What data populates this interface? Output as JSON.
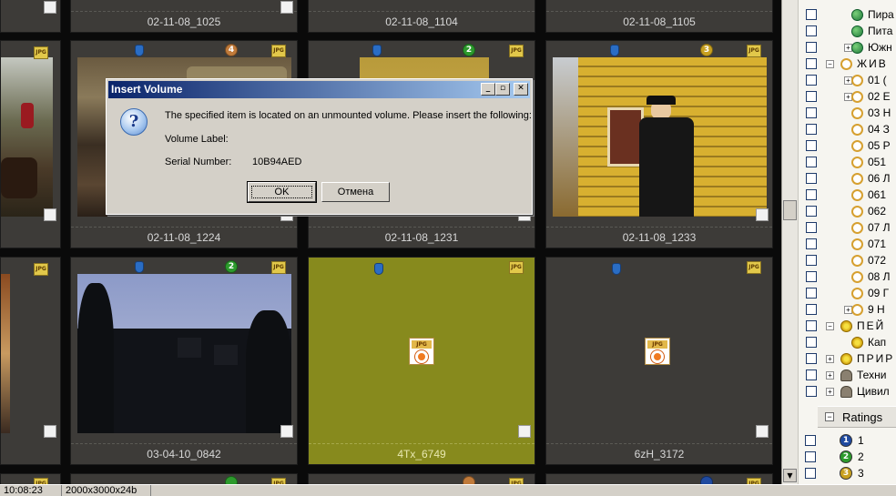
{
  "grid": {
    "thumbnails": [
      {
        "name": "02-11-08_1025"
      },
      {
        "name": "02-11-08_1104"
      },
      {
        "name": "02-11-08_1105"
      },
      {
        "name": "02-11-08_1224",
        "badge": "4"
      },
      {
        "name": "02-11-08_1231",
        "badge": "2"
      },
      {
        "name": "02-11-08_1233",
        "badge": "3"
      },
      {
        "name": "03-04-10_0842",
        "badge": "2"
      },
      {
        "name": "4Tx_6749"
      },
      {
        "name": "6zH_3172"
      }
    ],
    "file_type_label": "JPG",
    "selected_color": "#878a1d"
  },
  "tree": {
    "items": [
      {
        "label": "Пира",
        "icon": "globe-icon"
      },
      {
        "label": "Пита",
        "icon": "globe-icon"
      },
      {
        "label": "Южн",
        "icon": "globe-icon"
      },
      {
        "label": "ЖИВ",
        "icon": "tag-icon"
      },
      {
        "label": "01 (",
        "icon": "tag-icon"
      },
      {
        "label": "02 Е",
        "icon": "tag-icon"
      },
      {
        "label": "03 Н",
        "icon": "tag-icon"
      },
      {
        "label": "04 З",
        "icon": "tag-icon"
      },
      {
        "label": "05 Р",
        "icon": "tag-icon"
      },
      {
        "label": "051",
        "icon": "tag-icon"
      },
      {
        "label": "06 Л",
        "icon": "tag-icon"
      },
      {
        "label": "061",
        "icon": "tag-icon"
      },
      {
        "label": "062",
        "icon": "tag-icon"
      },
      {
        "label": "07 Л",
        "icon": "tag-icon"
      },
      {
        "label": "071",
        "icon": "tag-icon"
      },
      {
        "label": "072",
        "icon": "tag-icon"
      },
      {
        "label": "08 Л",
        "icon": "tag-icon"
      },
      {
        "label": "09 Г",
        "icon": "tag-icon"
      },
      {
        "label": "9 Н",
        "icon": "tag-icon"
      },
      {
        "label": "ПЕЙ",
        "icon": "flower-icon"
      },
      {
        "label": "Кап",
        "icon": "flower-icon"
      },
      {
        "label": "ПРИР",
        "icon": "flower-icon"
      },
      {
        "label": "Техни",
        "icon": "hat-icon"
      },
      {
        "label": "Цивил",
        "icon": "hat-icon"
      }
    ],
    "ratings": {
      "header": "Ratings",
      "items": [
        {
          "label": "1",
          "color": "#1f4aa0"
        },
        {
          "label": "2",
          "color": "#2c9a2c"
        },
        {
          "label": "3",
          "color": "#c8a020"
        }
      ]
    }
  },
  "status_bar": {
    "time": "10:08:23",
    "dimensions": "2000x3000x24b"
  },
  "dialog": {
    "title": "Insert Volume",
    "message": "The specified item is located on an unmounted volume. Please insert the following:",
    "volume_label_caption": "Volume Label:",
    "volume_label_value": "",
    "serial_caption": "Serial Number:",
    "serial_value": "10B94AED",
    "ok_label": "OK",
    "cancel_label": "Отмена",
    "icon": "question-icon"
  }
}
